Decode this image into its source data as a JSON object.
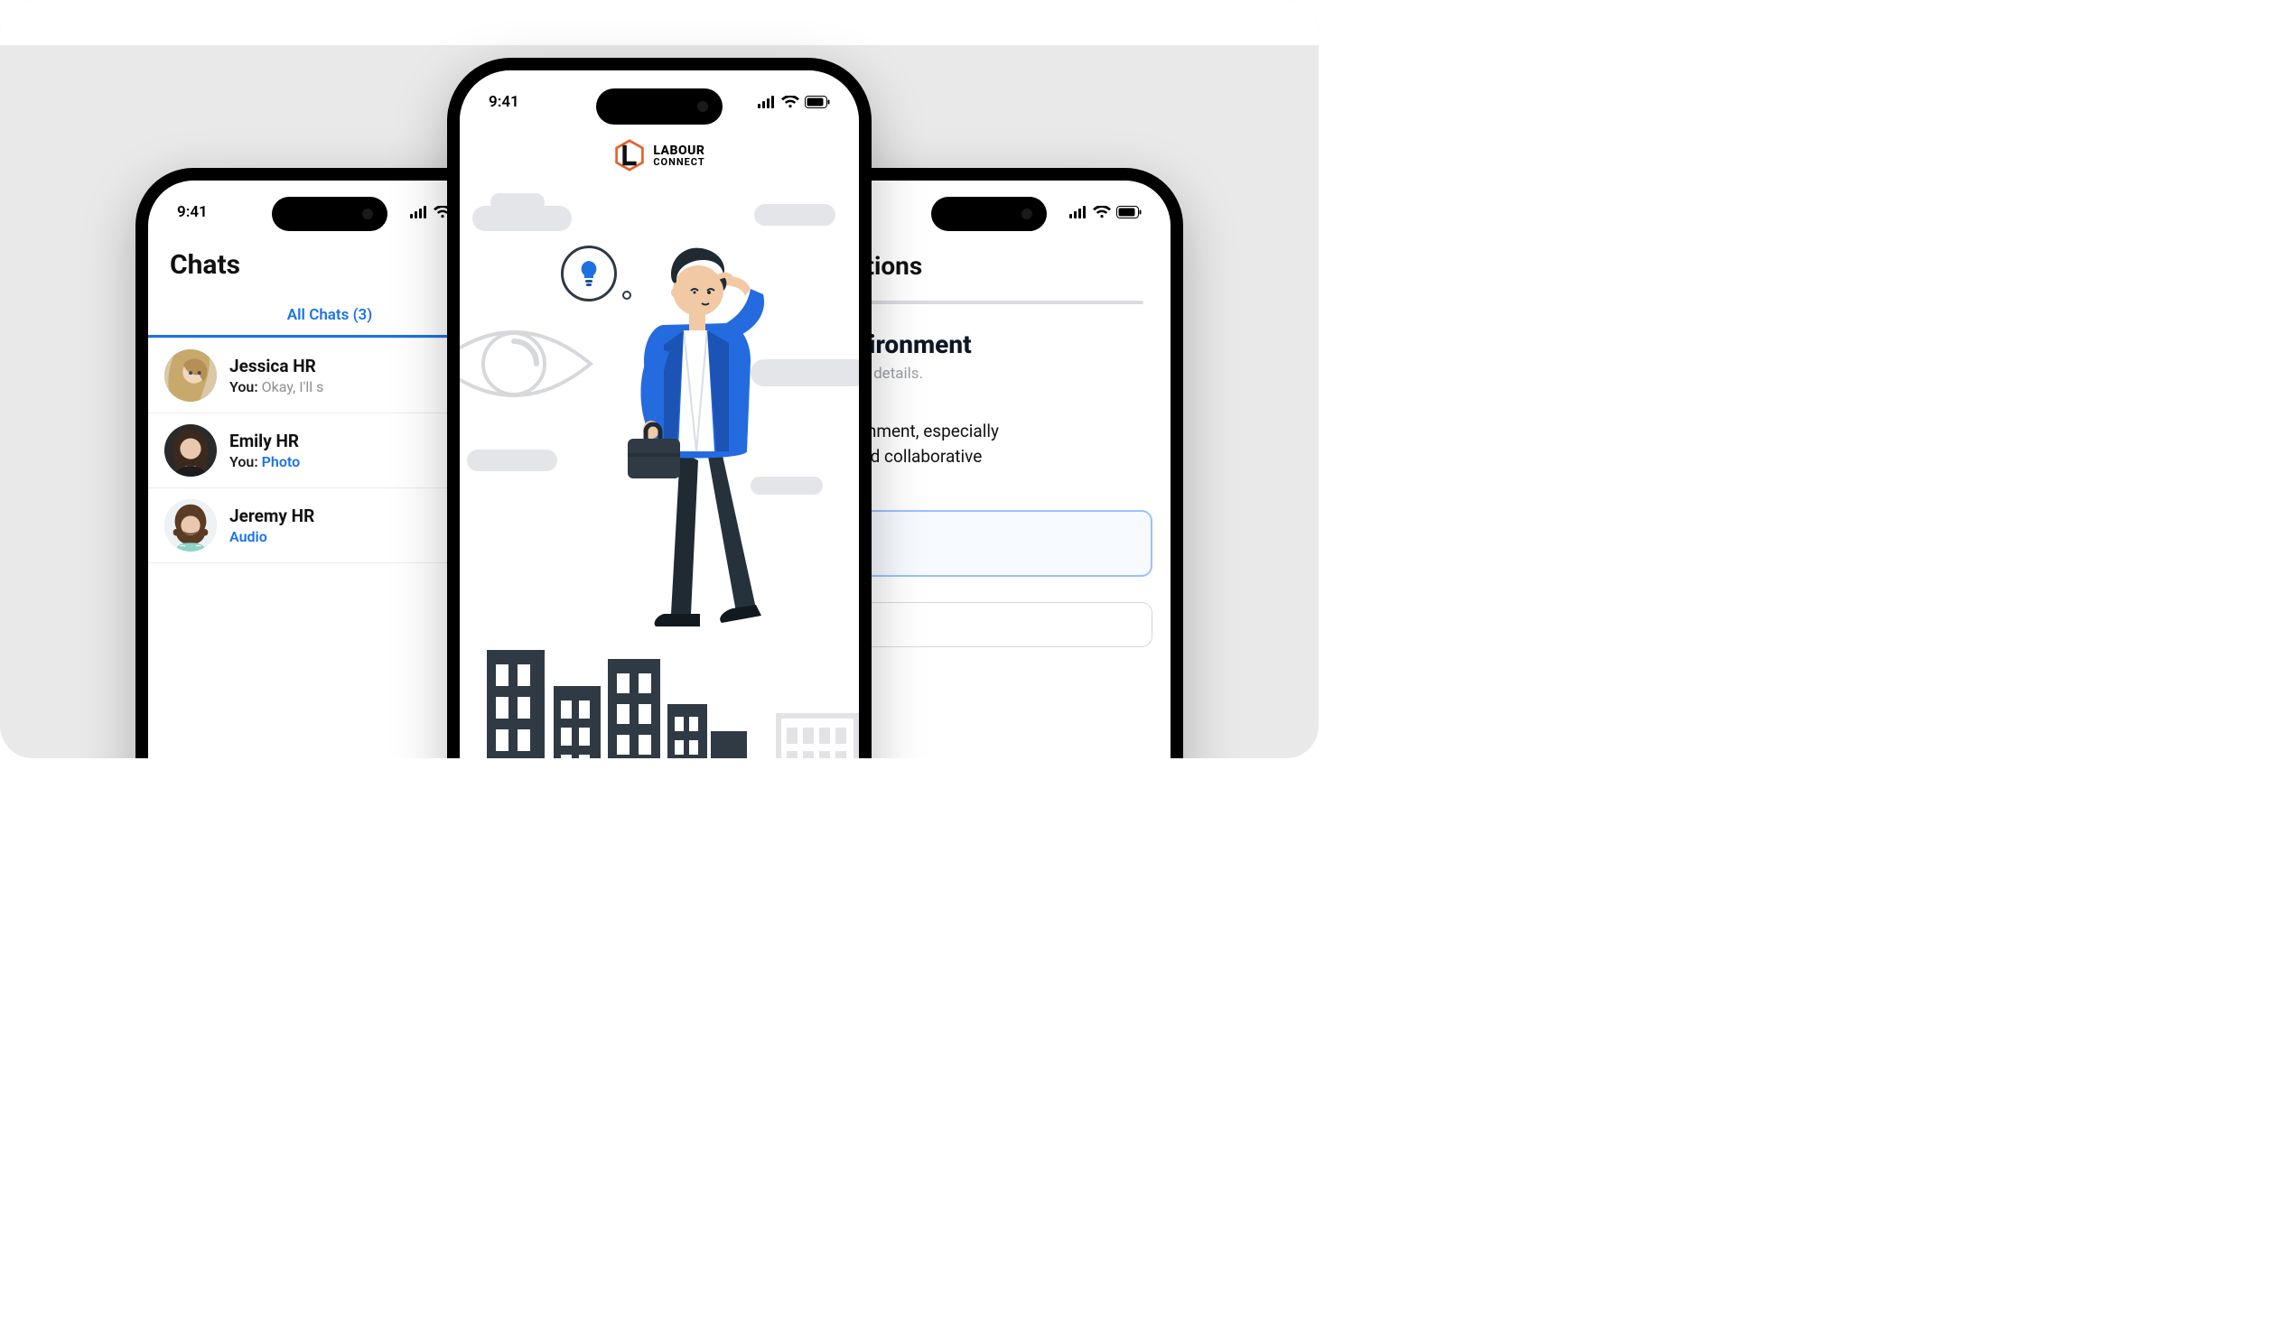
{
  "status": {
    "time": "9:41"
  },
  "leftPhone": {
    "title": "Chats",
    "tab_label": "All Chats (3)",
    "items": [
      {
        "name": "Jessica HR",
        "prefix": "You: ",
        "body": "Okay, I'll s",
        "style": "muted"
      },
      {
        "name": "Emily HR",
        "prefix": "You: ",
        "body": "Photo",
        "style": "accent"
      },
      {
        "name": "Jeremy HR",
        "prefix": "",
        "body": "Audio",
        "style": "accent"
      }
    ]
  },
  "centerPhone": {
    "brand_top": "LABOUR",
    "brand_bottom": "CONNECT"
  },
  "rightPhone": {
    "title": "Questions",
    "heading": "k Environment",
    "sub": "fessional details.",
    "body_line1": "k environment, especially",
    "body_line2": "ative, and collaborative"
  }
}
